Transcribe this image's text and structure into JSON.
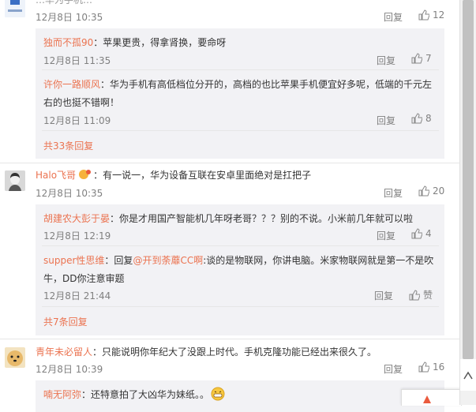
{
  "c1": {
    "top_text": "…华为手机…",
    "time": "12月8日 10:35",
    "reply": "回复",
    "likes": "12",
    "subs": [
      {
        "name": "独而不孤90",
        "text": "：苹果更贵，得拿肾换，要命呀",
        "time": "12月8日 11:35",
        "reply": "回复",
        "likes": "7"
      },
      {
        "name": "许你一路顺风",
        "text1": "：华为手机有高低档位分开的，高档的也比苹果手机便宜好多呢，低端的千元左",
        "text2": "右的也挺不错啊！",
        "time": "12月8日 11:09",
        "reply": "回复",
        "likes": "8"
      }
    ],
    "more": "共33条回复"
  },
  "c2": {
    "name": "Halo飞哥",
    "text": "：有一说一，华为设备互联在安卓里面绝对是扛把子",
    "time": "12月8日 10:35",
    "reply": "回复",
    "likes": "20",
    "subs": [
      {
        "name": "胡建农大彭于晏",
        "text": "：你是才用国产智能机几年呀老哥？？？别的不说。小米前几年就可以啦",
        "time": "12月8日 12:19",
        "reply": "回复",
        "likes": "4"
      },
      {
        "name": "supper性思维",
        "text_a": "：回复",
        "mention": "@开到荼蘼CC啊",
        "text_b": ":谈的是物联网，你讲电脑。米家物联网就是第一不是吹",
        "text2": "牛，DD你注意审题",
        "time": "12月8日 21:44",
        "reply": "回复",
        "likes": "赞"
      }
    ],
    "more": "共7条回复"
  },
  "c3": {
    "name": "青年未必留人",
    "text": "：只能说明你年纪大了没跟上时代。手机克隆功能已经出来很久了。",
    "time": "12月8日 10:39",
    "reply": "回复",
    "likes": "16",
    "subs": [
      {
        "name": "喃无阿弥",
        "text": "：还特意拍了大凶华为妹纸。。"
      }
    ]
  },
  "icons": {
    "thumb": "thumb-up-icon",
    "emoji": "grin-emoji-icon"
  },
  "colors": {
    "link": "#eb7350",
    "muted": "#808080",
    "subbox": "#f2f2f5"
  }
}
